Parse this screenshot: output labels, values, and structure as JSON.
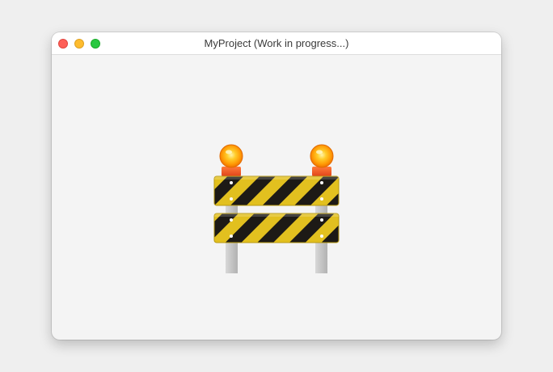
{
  "window": {
    "title": "MyProject (Work in progress...)"
  },
  "controls": {
    "close": "close-button",
    "minimize": "minimize-button",
    "zoom": "zoom-button"
  },
  "content": {
    "icon": "construction-barricade-icon",
    "colors": {
      "stripe_yellow": "#e6c21f",
      "stripe_black": "#1c1a17",
      "lamp_orange": "#ff8a00",
      "post_gray": "#c8c8c8"
    }
  }
}
